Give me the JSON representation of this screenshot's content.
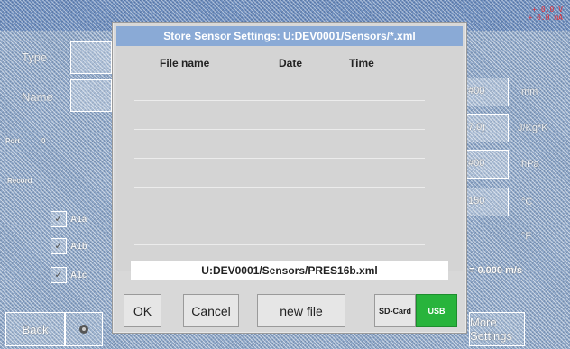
{
  "background": {
    "status_lines": [
      "+ 0.0 V",
      "+ 0.0 mA"
    ],
    "type_label": "Type",
    "name_label": "Name",
    "port_label": "Port",
    "port_value": "0",
    "record_label": "Record",
    "records": [
      {
        "check": "✓",
        "label": "A1a"
      },
      {
        "check": "✓",
        "label": "A1b"
      },
      {
        "check": "✓",
        "label": "A1c"
      }
    ],
    "right_values": [
      "#00",
      "7.0)",
      "#00",
      "150"
    ],
    "units": [
      "mm",
      "J/Kg*K",
      "hPa",
      "°C",
      "°F"
    ],
    "flow_readout": "= 0.000 m/s",
    "bottom_buttons": {
      "back": "Back",
      "settings": "More Settings"
    }
  },
  "dialog": {
    "title": "Store Sensor Settings:  U:DEV0001/Sensors/*.xml",
    "columns": {
      "file_name": "File name",
      "date": "Date",
      "time": "Time"
    },
    "selected_path": "U:DEV0001/Sensors/PRES16b.xml",
    "buttons": {
      "ok": "OK",
      "cancel": "Cancel",
      "new_file": "new file",
      "sd_card": "SD-Card",
      "usb": "USB"
    },
    "active_storage": "USB",
    "colors": {
      "title_bar": "#8aaad6",
      "usb_active": "#28b43c"
    }
  }
}
